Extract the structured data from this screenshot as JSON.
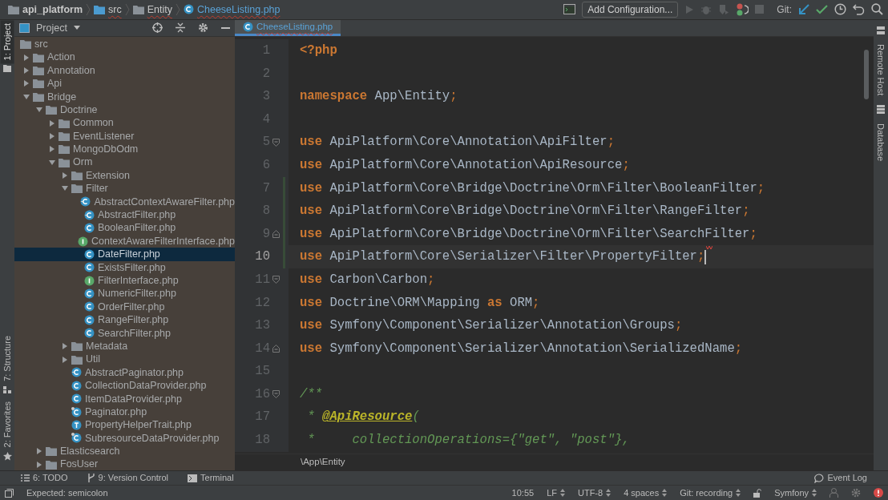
{
  "breadcrumbs": [
    {
      "label": "api_platform",
      "kind": "project",
      "error": false
    },
    {
      "label": "src",
      "kind": "source",
      "error": true
    },
    {
      "label": "Entity",
      "kind": "folder",
      "error": true
    },
    {
      "label": "CheeseListing.php",
      "kind": "class",
      "error": true
    }
  ],
  "toolbar": {
    "config_button": "Add Configuration...",
    "git_label": "Git:"
  },
  "left_strip": [
    {
      "label": "1: Project",
      "kind": "project",
      "selected": true
    },
    {
      "label": "7: Structure",
      "kind": "structure",
      "selected": false
    },
    {
      "label": "2: Favorites",
      "kind": "favorites",
      "selected": false
    }
  ],
  "right_strip": [
    {
      "label": "Remote Host",
      "kind": "remote"
    },
    {
      "label": "Database",
      "kind": "database"
    }
  ],
  "project_panel": {
    "title": "Project",
    "tree": [
      {
        "label": "src",
        "kind": "root",
        "selected": false,
        "children": [
          {
            "label": "Action",
            "kind": "folder",
            "expanded": false,
            "selected": false
          },
          {
            "label": "Annotation",
            "kind": "folder",
            "expanded": false,
            "selected": false
          },
          {
            "label": "Api",
            "kind": "folder",
            "expanded": false,
            "selected": false
          },
          {
            "label": "Bridge",
            "kind": "folder",
            "expanded": true,
            "selected": false,
            "children": [
              {
                "label": "Doctrine",
                "kind": "folder",
                "expanded": true,
                "selected": false,
                "children": [
                  {
                    "label": "Common",
                    "kind": "folder",
                    "expanded": false,
                    "selected": false
                  },
                  {
                    "label": "EventListener",
                    "kind": "folder",
                    "expanded": false,
                    "selected": false
                  },
                  {
                    "label": "MongoDbOdm",
                    "kind": "folder",
                    "expanded": false,
                    "selected": false
                  },
                  {
                    "label": "Orm",
                    "kind": "folder",
                    "expanded": true,
                    "selected": false,
                    "children": [
                      {
                        "label": "Extension",
                        "kind": "folder",
                        "expanded": false,
                        "selected": false
                      },
                      {
                        "label": "Filter",
                        "kind": "folder",
                        "expanded": true,
                        "selected": false,
                        "children": [
                          {
                            "label": "AbstractContextAwareFilter.php",
                            "kind": "abstract",
                            "selected": false
                          },
                          {
                            "label": "AbstractFilter.php",
                            "kind": "abstract",
                            "selected": false
                          },
                          {
                            "label": "BooleanFilter.php",
                            "kind": "class",
                            "selected": false
                          },
                          {
                            "label": "ContextAwareFilterInterface.php",
                            "kind": "interface",
                            "selected": false
                          },
                          {
                            "label": "DateFilter.php",
                            "kind": "class",
                            "selected": true
                          },
                          {
                            "label": "ExistsFilter.php",
                            "kind": "class",
                            "selected": false
                          },
                          {
                            "label": "FilterInterface.php",
                            "kind": "interface",
                            "selected": false
                          },
                          {
                            "label": "NumericFilter.php",
                            "kind": "class",
                            "selected": false
                          },
                          {
                            "label": "OrderFilter.php",
                            "kind": "class",
                            "selected": false
                          },
                          {
                            "label": "RangeFilter.php",
                            "kind": "class",
                            "selected": false
                          },
                          {
                            "label": "SearchFilter.php",
                            "kind": "class",
                            "selected": false
                          }
                        ]
                      },
                      {
                        "label": "Metadata",
                        "kind": "folder",
                        "expanded": false,
                        "selected": false
                      },
                      {
                        "label": "Util",
                        "kind": "folder",
                        "expanded": false,
                        "selected": false
                      },
                      {
                        "label": "AbstractPaginator.php",
                        "kind": "abstract",
                        "selected": false
                      },
                      {
                        "label": "CollectionDataProvider.php",
                        "kind": "class",
                        "selected": false
                      },
                      {
                        "label": "ItemDataProvider.php",
                        "kind": "class",
                        "selected": false
                      },
                      {
                        "label": "Paginator.php",
                        "kind": "final",
                        "selected": false
                      },
                      {
                        "label": "PropertyHelperTrait.php",
                        "kind": "trait",
                        "selected": false
                      },
                      {
                        "label": "SubresourceDataProvider.php",
                        "kind": "final",
                        "selected": false
                      }
                    ]
                  }
                ]
              },
              {
                "label": "Elasticsearch",
                "kind": "folder",
                "expanded": false,
                "selected": false
              },
              {
                "label": "FosUser",
                "kind": "folder",
                "expanded": false,
                "selected": false
              }
            ]
          }
        ]
      }
    ]
  },
  "editor": {
    "tabs": [
      {
        "label": "CheeseListing.php",
        "selected": true,
        "error": true
      }
    ],
    "lines": [
      {
        "number": "1",
        "current": false,
        "changed": false,
        "error": false,
        "tokens": [
          {
            "kind": "tag",
            "text": "<?php"
          }
        ]
      },
      {
        "number": "2",
        "current": false,
        "changed": false,
        "error": false
      },
      {
        "number": "3",
        "current": false,
        "changed": false,
        "error": false,
        "tokens": [
          {
            "kind": "keyword",
            "text": "namespace"
          },
          {
            "kind": "plain",
            "text": " App\\Entity"
          },
          {
            "kind": "punct",
            "text": ";"
          }
        ]
      },
      {
        "number": "4",
        "current": false,
        "changed": false,
        "error": false
      },
      {
        "number": "5",
        "current": false,
        "changed": false,
        "error": false,
        "fold_start": true,
        "tokens": [
          {
            "kind": "keyword",
            "text": "use"
          },
          {
            "kind": "plain",
            "text": " ApiPlatform\\Core\\Annotation\\ApiFilter"
          },
          {
            "kind": "punct",
            "text": ";"
          }
        ]
      },
      {
        "number": "6",
        "current": false,
        "changed": false,
        "error": false,
        "tokens": [
          {
            "kind": "keyword",
            "text": "use"
          },
          {
            "kind": "plain",
            "text": " ApiPlatform\\Core\\Annotation\\ApiResource"
          },
          {
            "kind": "punct",
            "text": ";"
          }
        ]
      },
      {
        "number": "7",
        "current": false,
        "changed": true,
        "error": false,
        "tokens": [
          {
            "kind": "keyword",
            "text": "use"
          },
          {
            "kind": "plain",
            "text": " ApiPlatform\\Core\\Bridge\\Doctrine\\Orm\\Filter\\BooleanFilter"
          },
          {
            "kind": "punct",
            "text": ";"
          }
        ]
      },
      {
        "number": "8",
        "current": false,
        "changed": true,
        "error": false,
        "tokens": [
          {
            "kind": "keyword",
            "text": "use"
          },
          {
            "kind": "plain",
            "text": " ApiPlatform\\Core\\Bridge\\Doctrine\\Orm\\Filter\\RangeFilter"
          },
          {
            "kind": "punct",
            "text": ";"
          }
        ]
      },
      {
        "number": "9",
        "current": false,
        "changed": true,
        "error": false,
        "fold_end": true,
        "tokens": [
          {
            "kind": "keyword",
            "text": "use"
          },
          {
            "kind": "plain",
            "text": " ApiPlatform\\Core\\Bridge\\Doctrine\\Orm\\Filter\\SearchFilter"
          },
          {
            "kind": "punct",
            "text": ";"
          }
        ]
      },
      {
        "number": "10",
        "current": true,
        "changed": true,
        "error": true,
        "tokens": [
          {
            "kind": "keyword",
            "text": "use"
          },
          {
            "kind": "plain",
            "text": " ApiPlatform\\Core\\Serializer\\Filter\\PropertyFilter"
          },
          {
            "kind": "punct",
            "text": ";"
          }
        ]
      },
      {
        "number": "11",
        "current": false,
        "changed": false,
        "error": false,
        "fold_start": true,
        "tokens": [
          {
            "kind": "keyword",
            "text": "use"
          },
          {
            "kind": "plain",
            "text": " Carbon\\Carbon"
          },
          {
            "kind": "punct",
            "text": ";"
          }
        ]
      },
      {
        "number": "12",
        "current": false,
        "changed": false,
        "error": false,
        "tokens": [
          {
            "kind": "keyword",
            "text": "use"
          },
          {
            "kind": "plain",
            "text": " Doctrine\\ORM\\Mapping "
          },
          {
            "kind": "keyword",
            "text": "as"
          },
          {
            "kind": "plain",
            "text": " ORM"
          },
          {
            "kind": "punct",
            "text": ";"
          }
        ]
      },
      {
        "number": "13",
        "current": false,
        "changed": false,
        "error": false,
        "tokens": [
          {
            "kind": "keyword",
            "text": "use"
          },
          {
            "kind": "plain",
            "text": " Symfony\\Component\\Serializer\\Annotation\\Groups"
          },
          {
            "kind": "punct",
            "text": ";"
          }
        ]
      },
      {
        "number": "14",
        "current": false,
        "changed": false,
        "error": false,
        "fold_end": true,
        "tokens": [
          {
            "kind": "keyword",
            "text": "use"
          },
          {
            "kind": "plain",
            "text": " Symfony\\Component\\Serializer\\Annotation\\SerializedName"
          },
          {
            "kind": "punct",
            "text": ";"
          }
        ]
      },
      {
        "number": "15",
        "current": false,
        "changed": false,
        "error": false
      },
      {
        "number": "16",
        "current": false,
        "changed": false,
        "error": false,
        "fold_start": true,
        "tokens": [
          {
            "kind": "doc",
            "text": "/**"
          }
        ]
      },
      {
        "number": "17",
        "current": false,
        "changed": false,
        "error": false,
        "tokens": [
          {
            "kind": "doc",
            "text": " * "
          },
          {
            "kind": "annotation",
            "text": "@ApiResource"
          },
          {
            "kind": "doc",
            "text": "("
          }
        ]
      },
      {
        "number": "18",
        "current": false,
        "changed": false,
        "error": false,
        "tokens": [
          {
            "kind": "doc",
            "text": " *     collectionOperations={\"get\", \"post\"},"
          }
        ]
      }
    ],
    "breadcrumb": "\\App\\Entity"
  },
  "tool_windows": [
    {
      "label": "6: TODO",
      "kind": "todo"
    },
    {
      "label": "9: Version Control",
      "kind": "vcs"
    },
    {
      "label": "Terminal",
      "kind": "terminal"
    }
  ],
  "event_log": "Event Log",
  "status": {
    "message": "Expected: semicolon",
    "items": [
      {
        "label": "10:55",
        "kind": "text"
      },
      {
        "label": "LF",
        "kind": "menu"
      },
      {
        "label": "UTF-8",
        "kind": "menu"
      },
      {
        "label": "4 spaces",
        "kind": "menu"
      },
      {
        "label": "Git: recording",
        "kind": "menu"
      },
      {
        "kind": "lock"
      },
      {
        "label": "Symfony",
        "kind": "menu"
      },
      {
        "kind": "person"
      },
      {
        "kind": "gear"
      },
      {
        "kind": "alert"
      }
    ]
  }
}
